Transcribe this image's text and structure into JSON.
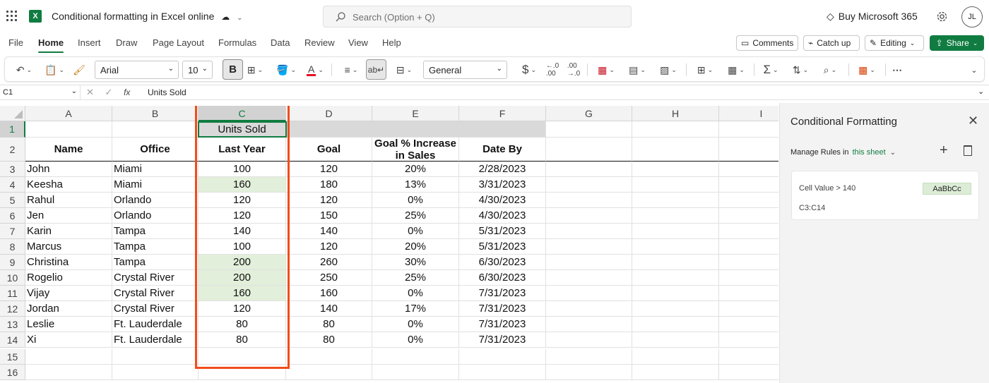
{
  "app": {
    "title": "Conditional formatting in Excel online",
    "search_placeholder": "Search (Option + Q)",
    "buy_label": "Buy Microsoft 365",
    "avatar_initials": "JL"
  },
  "menu": {
    "tabs": [
      "File",
      "Home",
      "Insert",
      "Draw",
      "Page Layout",
      "Formulas",
      "Data",
      "Review",
      "View",
      "Help"
    ],
    "active_tab": "Home",
    "comments_label": "Comments",
    "catchup_label": "Catch up",
    "editing_label": "Editing",
    "share_label": "Share"
  },
  "ribbon": {
    "font_name": "Arial",
    "font_size": "10",
    "bold_label": "B",
    "number_format": "General",
    "currency_symbol": "$",
    "sum_symbol": "Σ",
    "more_label": "⋯"
  },
  "formula_bar": {
    "name_box": "C1",
    "fx_label": "fx",
    "formula": "Units Sold"
  },
  "grid": {
    "columns": [
      "A",
      "B",
      "C",
      "D",
      "E",
      "F",
      "G",
      "H",
      "I"
    ],
    "rows": [
      "1",
      "2",
      "3",
      "4",
      "5",
      "6",
      "7",
      "8",
      "9",
      "10",
      "11",
      "12",
      "13",
      "14",
      "15",
      "16"
    ],
    "selected_column": "C",
    "selected_row": "1",
    "highlight_color": "#e2efda",
    "highlight_border_color": "#f24c1b",
    "c1": "Units Sold",
    "headers": {
      "name": "Name",
      "office": "Office",
      "last_year": "Last Year",
      "goal": "Goal",
      "goal_pct_line1": "Goal % Increase",
      "goal_pct_line2": "in Sales",
      "date_by": "Date By"
    },
    "data": [
      {
        "name": "John",
        "office": "Miami",
        "last_year": "100",
        "goal": "120",
        "pct": "20%",
        "date": "2/28/2023",
        "highlight": false
      },
      {
        "name": "Keesha",
        "office": "Miami",
        "last_year": "160",
        "goal": "180",
        "pct": "13%",
        "date": "3/31/2023",
        "highlight": true
      },
      {
        "name": "Rahul",
        "office": "Orlando",
        "last_year": "120",
        "goal": "120",
        "pct": "0%",
        "date": "4/30/2023",
        "highlight": false
      },
      {
        "name": "Jen",
        "office": "Orlando",
        "last_year": "120",
        "goal": "150",
        "pct": "25%",
        "date": "4/30/2023",
        "highlight": false
      },
      {
        "name": "Karin",
        "office": "Tampa",
        "last_year": "140",
        "goal": "140",
        "pct": "0%",
        "date": "5/31/2023",
        "highlight": false
      },
      {
        "name": "Marcus",
        "office": "Tampa",
        "last_year": "100",
        "goal": "120",
        "pct": "20%",
        "date": "5/31/2023",
        "highlight": false
      },
      {
        "name": "Christina",
        "office": "Tampa",
        "last_year": "200",
        "goal": "260",
        "pct": "30%",
        "date": "6/30/2023",
        "highlight": true
      },
      {
        "name": "Rogelio",
        "office": "Crystal River",
        "last_year": "200",
        "goal": "250",
        "pct": "25%",
        "date": "6/30/2023",
        "highlight": true
      },
      {
        "name": "Vijay",
        "office": "Crystal River",
        "last_year": "160",
        "goal": "160",
        "pct": "0%",
        "date": "7/31/2023",
        "highlight": true
      },
      {
        "name": "Jordan",
        "office": "Crystal River",
        "last_year": "120",
        "goal": "140",
        "pct": "17%",
        "date": "7/31/2023",
        "highlight": false
      },
      {
        "name": "Leslie",
        "office": "Ft. Lauderdale",
        "last_year": "80",
        "goal": "80",
        "pct": "0%",
        "date": "7/31/2023",
        "highlight": false
      },
      {
        "name": "Xi",
        "office": "Ft. Lauderdale",
        "last_year": "80",
        "goal": "80",
        "pct": "0%",
        "date": "7/31/2023",
        "highlight": false
      }
    ]
  },
  "panel": {
    "title": "Conditional Formatting",
    "close_label": "✕",
    "manage_label": "Manage Rules in",
    "scope_label": "this sheet",
    "rule": {
      "condition": "Cell Value > 140",
      "sample": "AaBbCc",
      "range": "C3:C14"
    }
  }
}
